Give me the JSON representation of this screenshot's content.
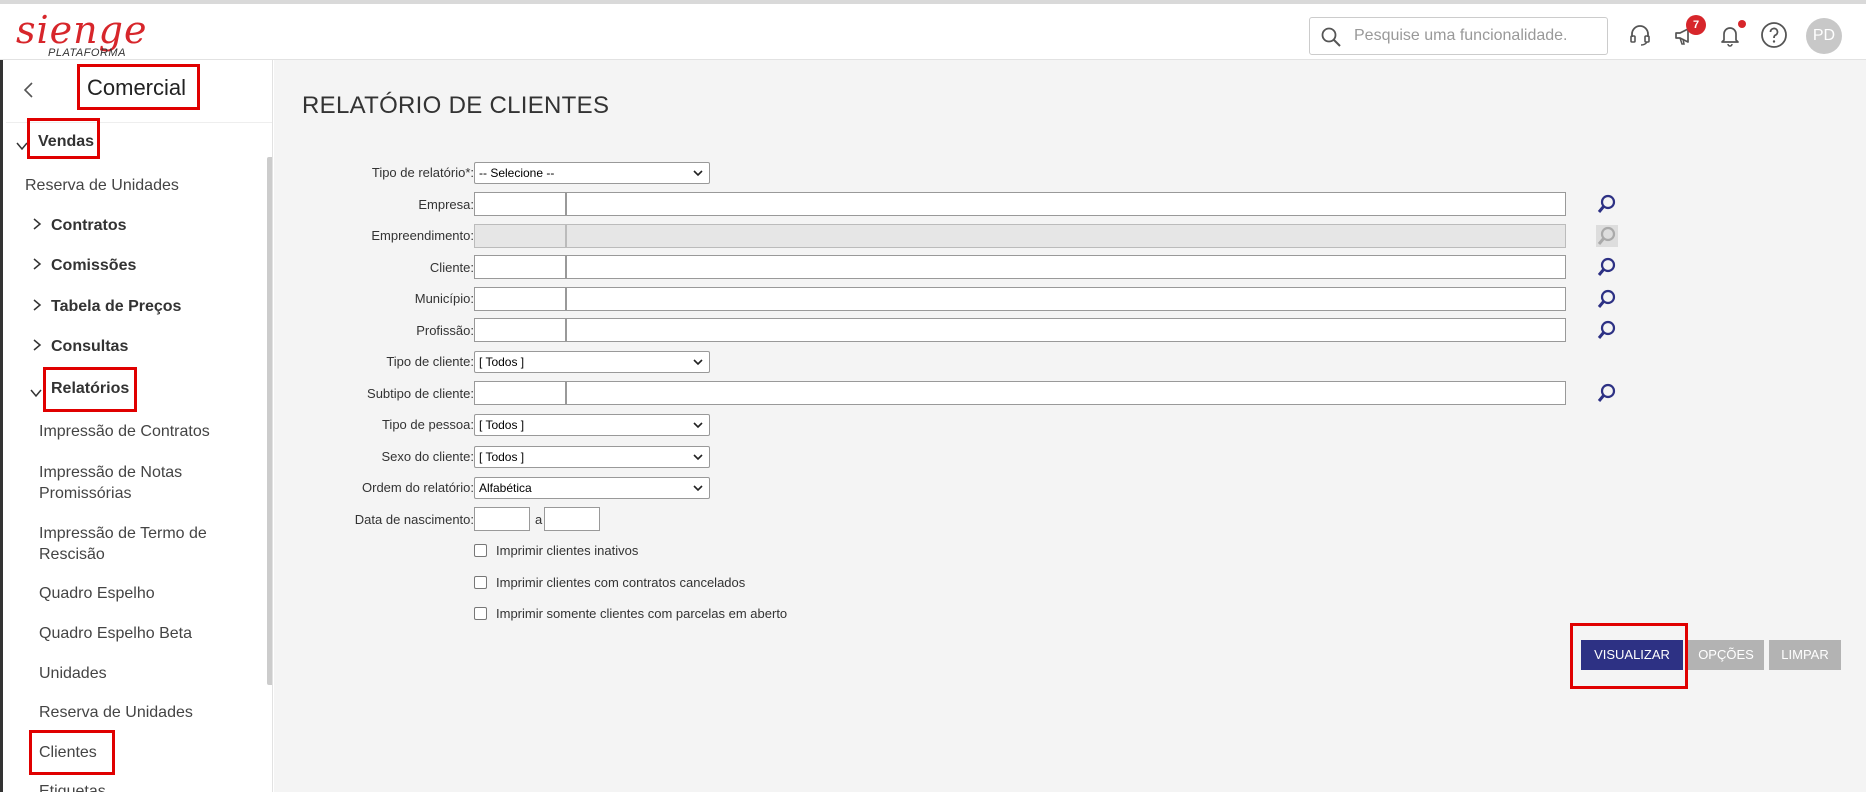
{
  "header": {
    "logo_text": "sienge",
    "logo_sub": "PLATAFORMA",
    "search_placeholder": "Pesquise uma funcionalidade.",
    "announcements_badge": "7",
    "avatar_initials": "PD"
  },
  "sidebar": {
    "module_title": "Comercial",
    "section": "Vendas",
    "items": [
      {
        "label": "Reserva de Unidades"
      },
      {
        "label": "Contratos"
      },
      {
        "label": "Comissões"
      },
      {
        "label": "Tabela de Preços"
      },
      {
        "label": "Consultas"
      },
      {
        "label": "Relatórios"
      }
    ],
    "reports": [
      {
        "label": "Impressão de Contratos"
      },
      {
        "label": "Impressão de Notas Promissórias"
      },
      {
        "label": "Impressão de Termo de Rescisão"
      },
      {
        "label": "Quadro Espelho"
      },
      {
        "label": "Quadro Espelho Beta"
      },
      {
        "label": "Unidades"
      },
      {
        "label": "Reserva de Unidades"
      },
      {
        "label": "Clientes"
      },
      {
        "label": "Etiquetas"
      }
    ]
  },
  "main": {
    "title": "RELATÓRIO DE CLIENTES",
    "fields": {
      "tipo_relatorio": {
        "label": "Tipo de relatório*:",
        "value": "-- Selecione --"
      },
      "empresa": {
        "label": "Empresa:"
      },
      "empreendimento": {
        "label": "Empreendimento:"
      },
      "cliente": {
        "label": "Cliente:"
      },
      "municipio": {
        "label": "Município:"
      },
      "profissao": {
        "label": "Profissão:"
      },
      "tipo_cliente": {
        "label": "Tipo de cliente:",
        "value": "[ Todos ]"
      },
      "subtipo_cliente": {
        "label": "Subtipo de cliente:"
      },
      "tipo_pessoa": {
        "label": "Tipo de pessoa:",
        "value": "[ Todos ]"
      },
      "sexo_cliente": {
        "label": "Sexo do cliente:",
        "value": "[ Todos ]"
      },
      "ordem_relatorio": {
        "label": "Ordem do relatório:",
        "value": "Alfabética"
      },
      "data_nascimento": {
        "label": "Data de nascimento:",
        "separator": "a"
      }
    },
    "checkboxes": [
      {
        "label": "Imprimir clientes inativos"
      },
      {
        "label": "Imprimir clientes com contratos cancelados"
      },
      {
        "label": "Imprimir somente clientes com parcelas em aberto"
      }
    ],
    "buttons": {
      "visualizar": "VISUALIZAR",
      "opcoes": "OPÇÕES",
      "limpar": "LIMPAR"
    }
  }
}
